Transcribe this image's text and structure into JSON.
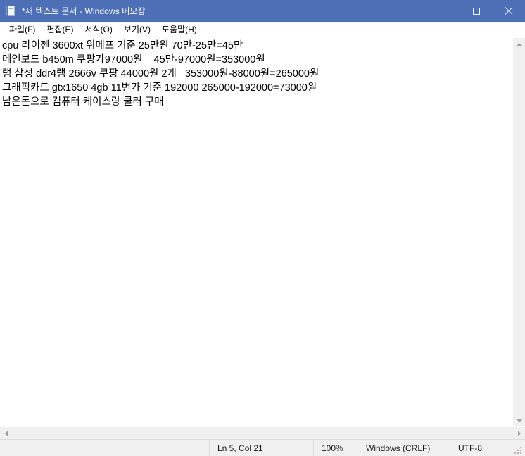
{
  "window": {
    "title": "*새 텍스트 문서 - Windows 메모장",
    "icon": "notepad-icon",
    "titlebar_color": "#4c6fb5",
    "controls": {
      "minimize": "minimize-icon",
      "maximize": "maximize-icon",
      "close": "close-icon"
    }
  },
  "menubar": {
    "items": [
      {
        "label": "파일(F)"
      },
      {
        "label": "편집(E)"
      },
      {
        "label": "서식(O)"
      },
      {
        "label": "보기(V)"
      },
      {
        "label": "도움말(H)"
      }
    ]
  },
  "editor": {
    "lines": [
      "cpu 라이젠 3600xt 위메프 기준 25만원 70만-25만=45만",
      "메인보드 b450m 쿠팡가97000원    45만-97000원=353000원",
      "램 삼성 ddr4램 2666v 쿠팡 44000원 2개   353000원-88000원=265000원",
      "그래픽카드 gtx1650 4gb 11번가 기준 192000 265000-192000=73000원",
      "남은돈으로 컴퓨터 케이스랑 쿨러 구매"
    ]
  },
  "scrollbars": {
    "vertical": {
      "up": "scroll-up-icon",
      "down": "scroll-down-icon"
    },
    "horizontal": {
      "left": "scroll-left-icon",
      "right": "scroll-right-icon"
    }
  },
  "statusbar": {
    "cursor_position": "Ln 5, Col 21",
    "zoom": "100%",
    "line_ending": "Windows (CRLF)",
    "encoding": "UTF-8"
  }
}
